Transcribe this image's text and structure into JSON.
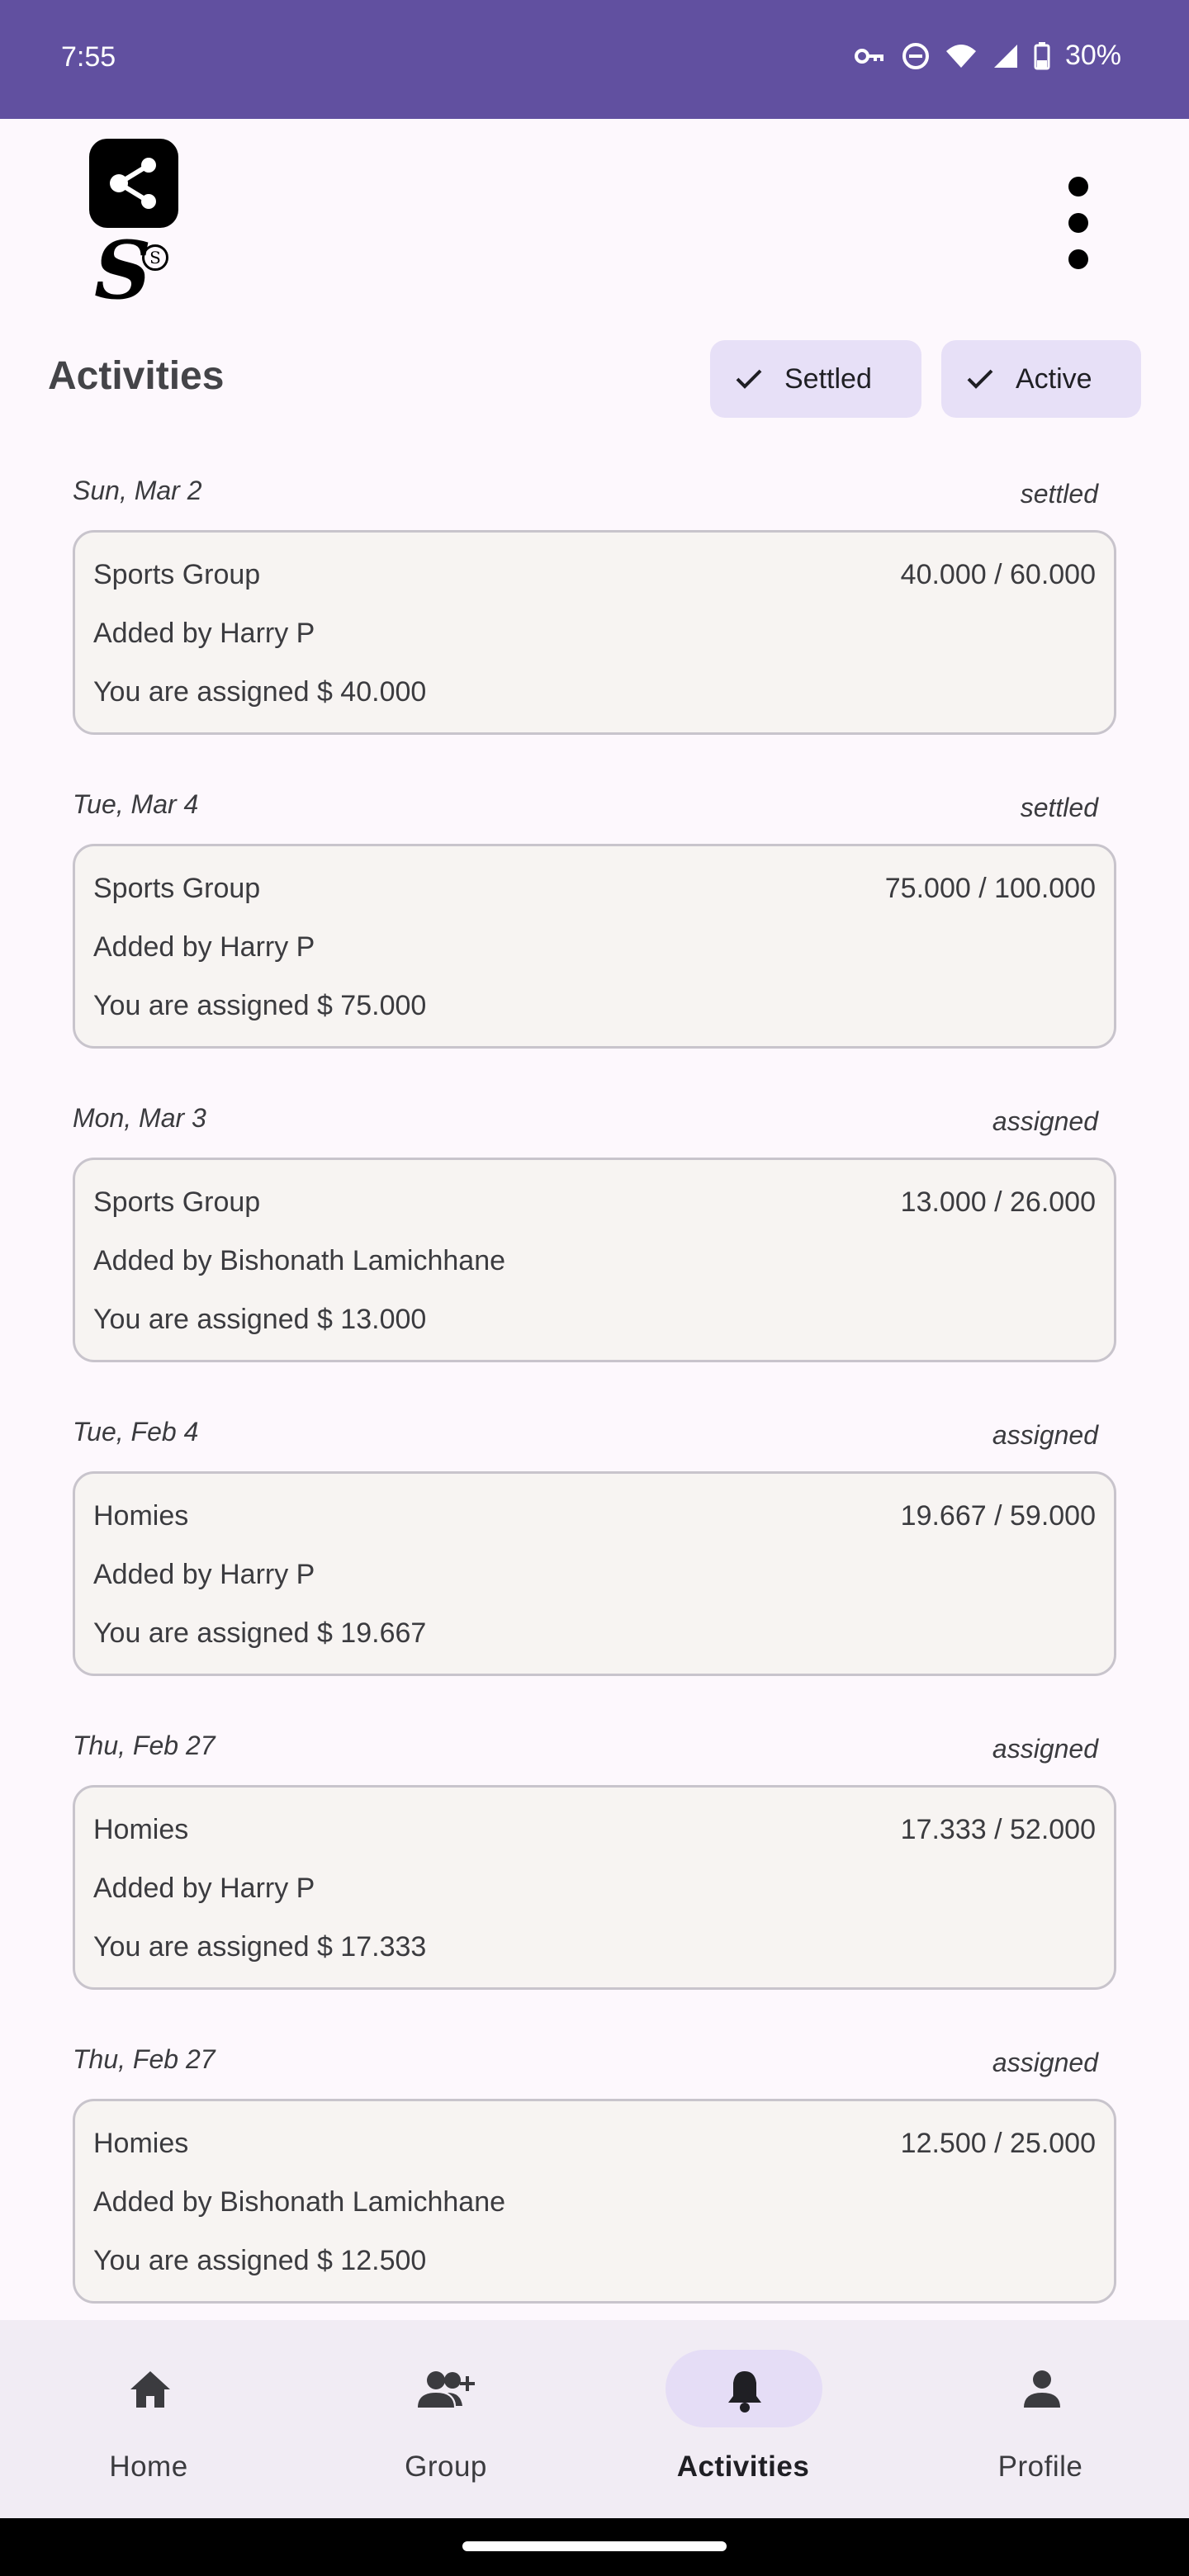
{
  "status_bar": {
    "time": "7:55",
    "battery": "30%"
  },
  "header": {
    "title": "Activities"
  },
  "filters": [
    {
      "label": "Settled",
      "selected": true
    },
    {
      "label": "Active",
      "selected": true
    }
  ],
  "activities": [
    {
      "date": "Sun, Mar 2",
      "status": "settled",
      "group": "Sports Group",
      "amount": "40.000 / 60.000",
      "added_by": "Added by Harry P",
      "assigned": "You are assigned $ 40.000"
    },
    {
      "date": "Tue, Mar 4",
      "status": "settled",
      "group": "Sports Group",
      "amount": "75.000 / 100.000",
      "added_by": "Added by Harry P",
      "assigned": "You are assigned $ 75.000"
    },
    {
      "date": "Mon, Mar 3",
      "status": "assigned",
      "group": "Sports Group",
      "amount": "13.000 / 26.000",
      "added_by": "Added by Bishonath Lamichhane",
      "assigned": "You are assigned $ 13.000"
    },
    {
      "date": "Tue, Feb 4",
      "status": "assigned",
      "group": "Homies",
      "amount": "19.667 / 59.000",
      "added_by": "Added by Harry P",
      "assigned": "You are assigned $ 19.667"
    },
    {
      "date": "Thu, Feb 27",
      "status": "assigned",
      "group": "Homies",
      "amount": "17.333 / 52.000",
      "added_by": "Added by Harry P",
      "assigned": "You are assigned $ 17.333"
    },
    {
      "date": "Thu, Feb 27",
      "status": "assigned",
      "group": "Homies",
      "amount": "12.500 / 25.000",
      "added_by": "Added by Bishonath Lamichhane",
      "assigned": "You are assigned $ 12.500"
    }
  ],
  "nav": [
    {
      "label": "Home",
      "icon": "home-icon"
    },
    {
      "label": "Group",
      "icon": "add-group-icon"
    },
    {
      "label": "Activities",
      "icon": "bell-icon",
      "active": true
    },
    {
      "label": "Profile",
      "icon": "person-icon"
    }
  ],
  "colors": {
    "status_bar": "#6150a0",
    "chip": "#e7e0f7",
    "card_bg": "#f7f4f2",
    "nav_bg": "#f1ecf4"
  }
}
